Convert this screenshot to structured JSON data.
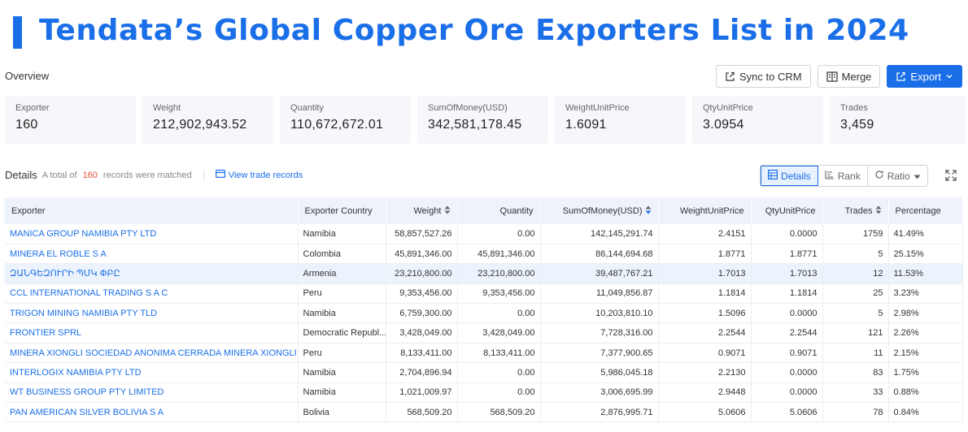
{
  "title": "Tendata’s Global Copper Ore Exporters List in 2024",
  "overview": {
    "label": "Overview"
  },
  "toolbar": {
    "sync_label": "Sync to CRM",
    "merge_label": "Merge",
    "export_label": "Export"
  },
  "stats": [
    {
      "label": "Exporter",
      "value": "160"
    },
    {
      "label": "Weight",
      "value": "212,902,943.52"
    },
    {
      "label": "Quantity",
      "value": "110,672,672.01"
    },
    {
      "label": "SumOfMoney(USD)",
      "value": "342,581,178.45"
    },
    {
      "label": "WeightUnitPrice",
      "value": "1.6091"
    },
    {
      "label": "QtyUnitPrice",
      "value": "3.0954"
    },
    {
      "label": "Trades",
      "value": "3,459"
    }
  ],
  "details": {
    "title": "Details",
    "prefix": "A total of",
    "count": "160",
    "suffix": "records were matched",
    "view_link": "View trade records"
  },
  "view_tabs": {
    "details": "Details",
    "rank": "Rank",
    "ratio": "Ratio"
  },
  "table": {
    "headers": [
      "Exporter",
      "Exporter Country",
      "Weight",
      "Quantity",
      "SumOfMoney(USD)",
      "WeightUnitPrice",
      "QtyUnitPrice",
      "Trades",
      "Percentage"
    ],
    "rows": [
      [
        "MANICA GROUP NAMIBIA PTY LTD",
        "Namibia",
        "58,857,527.26",
        "0.00",
        "142,145,291.74",
        "2.4151",
        "0.0000",
        "1759",
        "41.49%"
      ],
      [
        "MINERA EL ROBLE S A",
        "Colombia",
        "45,891,346.00",
        "45,891,346.00",
        "86,144,694.68",
        "1.8771",
        "1.8771",
        "5",
        "25.15%"
      ],
      [
        "ԶԱՆԳԵԶՈՒՐԻ ՊՄԿ ՓԲԸ",
        "Armenia",
        "23,210,800.00",
        "23,210,800.00",
        "39,487,767.21",
        "1.7013",
        "1.7013",
        "12",
        "11.53%"
      ],
      [
        "CCL INTERNATIONAL TRADING S A C",
        "Peru",
        "9,353,456.00",
        "9,353,456.00",
        "11,049,856.87",
        "1.1814",
        "1.1814",
        "25",
        "3.23%"
      ],
      [
        "TRIGON MINING NAMIBIA PTY TLD",
        "Namibia",
        "6,759,300.00",
        "0.00",
        "10,203,810.10",
        "1.5096",
        "0.0000",
        "5",
        "2.98%"
      ],
      [
        "FRONTIER SPRL",
        "Democratic Republ...",
        "3,428,049.00",
        "3,428,049.00",
        "7,728,316.00",
        "2.2544",
        "2.2544",
        "121",
        "2.26%"
      ],
      [
        "MINERA XIONGLI SOCIEDAD ANONIMA CERRADA MINERA XIONGLI S A C",
        "Peru",
        "8,133,411.00",
        "8,133,411.00",
        "7,377,900.65",
        "0.9071",
        "0.9071",
        "11",
        "2.15%"
      ],
      [
        "INTERLOGIX NAMIBIA PTY LTD",
        "Namibia",
        "2,704,896.94",
        "0.00",
        "5,986,045.18",
        "2.2130",
        "0.0000",
        "83",
        "1.75%"
      ],
      [
        "WT BUSINESS GROUP PTY LIMITED",
        "Namibia",
        "1,021,009.97",
        "0.00",
        "3,006,695.99",
        "2.9448",
        "0.0000",
        "33",
        "0.88%"
      ],
      [
        "PAN AMERICAN SILVER BOLIVIA S A",
        "Bolivia",
        "568,509.20",
        "568,509.20",
        "2,876,995.71",
        "5.0606",
        "5.0606",
        "78",
        "0.84%"
      ]
    ]
  },
  "colors": {
    "accent": "#1a6fe8",
    "count": "#e8513a",
    "card_bg": "#f5f7fa",
    "header_bg": "#eef3fb"
  }
}
